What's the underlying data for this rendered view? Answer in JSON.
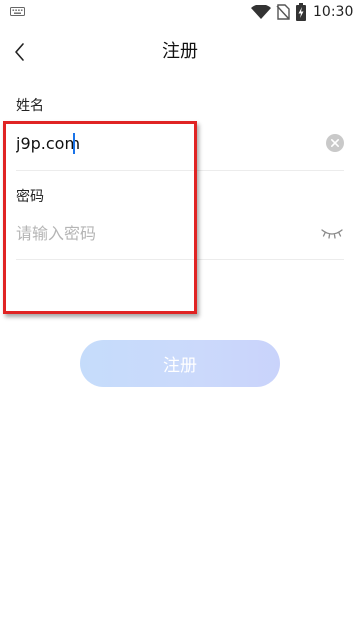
{
  "status_bar": {
    "time": "10:30",
    "icons": [
      "keyboard-icon",
      "wifi-icon",
      "no-sim-icon",
      "battery-charging-icon"
    ]
  },
  "header": {
    "title": "注册",
    "back_icon": "chevron-left-icon"
  },
  "form": {
    "name": {
      "label": "姓名",
      "value": "j9p.com",
      "clear_icon": "clear-circle-icon"
    },
    "password": {
      "label": "密码",
      "placeholder": "请输入密码",
      "value": "",
      "toggle_icon": "eye-closed-icon"
    }
  },
  "register_button": {
    "label": "注册"
  },
  "colors": {
    "accent": "#1a73e8",
    "highlight": "#e02424",
    "button_gradient_start": "#c5dcfb",
    "button_gradient_end": "#c9d3fb"
  }
}
